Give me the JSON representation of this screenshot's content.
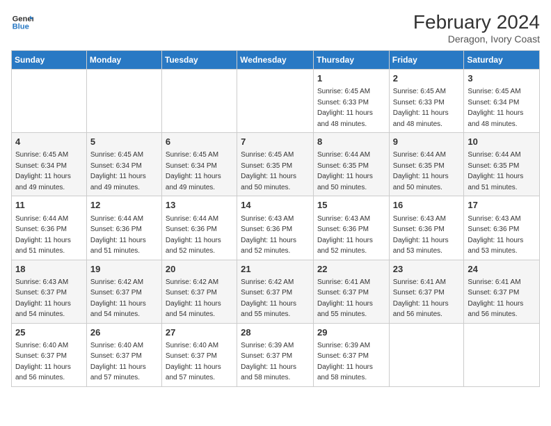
{
  "header": {
    "logo_line1": "General",
    "logo_line2": "Blue",
    "title": "February 2024",
    "subtitle": "Deragon, Ivory Coast"
  },
  "weekdays": [
    "Sunday",
    "Monday",
    "Tuesday",
    "Wednesday",
    "Thursday",
    "Friday",
    "Saturday"
  ],
  "weeks": [
    [
      {
        "day": "",
        "info": ""
      },
      {
        "day": "",
        "info": ""
      },
      {
        "day": "",
        "info": ""
      },
      {
        "day": "",
        "info": ""
      },
      {
        "day": "1",
        "info": "Sunrise: 6:45 AM\nSunset: 6:33 PM\nDaylight: 11 hours and 48 minutes."
      },
      {
        "day": "2",
        "info": "Sunrise: 6:45 AM\nSunset: 6:33 PM\nDaylight: 11 hours and 48 minutes."
      },
      {
        "day": "3",
        "info": "Sunrise: 6:45 AM\nSunset: 6:34 PM\nDaylight: 11 hours and 48 minutes."
      }
    ],
    [
      {
        "day": "4",
        "info": "Sunrise: 6:45 AM\nSunset: 6:34 PM\nDaylight: 11 hours and 49 minutes."
      },
      {
        "day": "5",
        "info": "Sunrise: 6:45 AM\nSunset: 6:34 PM\nDaylight: 11 hours and 49 minutes."
      },
      {
        "day": "6",
        "info": "Sunrise: 6:45 AM\nSunset: 6:34 PM\nDaylight: 11 hours and 49 minutes."
      },
      {
        "day": "7",
        "info": "Sunrise: 6:45 AM\nSunset: 6:35 PM\nDaylight: 11 hours and 50 minutes."
      },
      {
        "day": "8",
        "info": "Sunrise: 6:44 AM\nSunset: 6:35 PM\nDaylight: 11 hours and 50 minutes."
      },
      {
        "day": "9",
        "info": "Sunrise: 6:44 AM\nSunset: 6:35 PM\nDaylight: 11 hours and 50 minutes."
      },
      {
        "day": "10",
        "info": "Sunrise: 6:44 AM\nSunset: 6:35 PM\nDaylight: 11 hours and 51 minutes."
      }
    ],
    [
      {
        "day": "11",
        "info": "Sunrise: 6:44 AM\nSunset: 6:36 PM\nDaylight: 11 hours and 51 minutes."
      },
      {
        "day": "12",
        "info": "Sunrise: 6:44 AM\nSunset: 6:36 PM\nDaylight: 11 hours and 51 minutes."
      },
      {
        "day": "13",
        "info": "Sunrise: 6:44 AM\nSunset: 6:36 PM\nDaylight: 11 hours and 52 minutes."
      },
      {
        "day": "14",
        "info": "Sunrise: 6:43 AM\nSunset: 6:36 PM\nDaylight: 11 hours and 52 minutes."
      },
      {
        "day": "15",
        "info": "Sunrise: 6:43 AM\nSunset: 6:36 PM\nDaylight: 11 hours and 52 minutes."
      },
      {
        "day": "16",
        "info": "Sunrise: 6:43 AM\nSunset: 6:36 PM\nDaylight: 11 hours and 53 minutes."
      },
      {
        "day": "17",
        "info": "Sunrise: 6:43 AM\nSunset: 6:36 PM\nDaylight: 11 hours and 53 minutes."
      }
    ],
    [
      {
        "day": "18",
        "info": "Sunrise: 6:43 AM\nSunset: 6:37 PM\nDaylight: 11 hours and 54 minutes."
      },
      {
        "day": "19",
        "info": "Sunrise: 6:42 AM\nSunset: 6:37 PM\nDaylight: 11 hours and 54 minutes."
      },
      {
        "day": "20",
        "info": "Sunrise: 6:42 AM\nSunset: 6:37 PM\nDaylight: 11 hours and 54 minutes."
      },
      {
        "day": "21",
        "info": "Sunrise: 6:42 AM\nSunset: 6:37 PM\nDaylight: 11 hours and 55 minutes."
      },
      {
        "day": "22",
        "info": "Sunrise: 6:41 AM\nSunset: 6:37 PM\nDaylight: 11 hours and 55 minutes."
      },
      {
        "day": "23",
        "info": "Sunrise: 6:41 AM\nSunset: 6:37 PM\nDaylight: 11 hours and 56 minutes."
      },
      {
        "day": "24",
        "info": "Sunrise: 6:41 AM\nSunset: 6:37 PM\nDaylight: 11 hours and 56 minutes."
      }
    ],
    [
      {
        "day": "25",
        "info": "Sunrise: 6:40 AM\nSunset: 6:37 PM\nDaylight: 11 hours and 56 minutes."
      },
      {
        "day": "26",
        "info": "Sunrise: 6:40 AM\nSunset: 6:37 PM\nDaylight: 11 hours and 57 minutes."
      },
      {
        "day": "27",
        "info": "Sunrise: 6:40 AM\nSunset: 6:37 PM\nDaylight: 11 hours and 57 minutes."
      },
      {
        "day": "28",
        "info": "Sunrise: 6:39 AM\nSunset: 6:37 PM\nDaylight: 11 hours and 58 minutes."
      },
      {
        "day": "29",
        "info": "Sunrise: 6:39 AM\nSunset: 6:37 PM\nDaylight: 11 hours and 58 minutes."
      },
      {
        "day": "",
        "info": ""
      },
      {
        "day": "",
        "info": ""
      }
    ]
  ]
}
